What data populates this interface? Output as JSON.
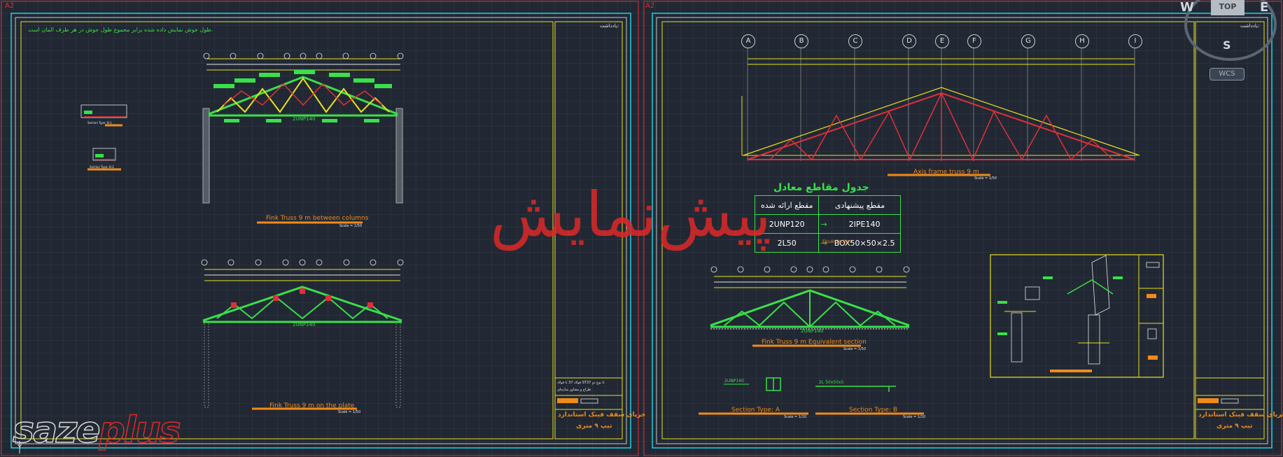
{
  "sheets": [
    {
      "tab": "A2"
    },
    {
      "tab": "A2"
    }
  ],
  "left_sheet": {
    "note": "طول جوش نمایش داده شده برابر مجموع طول جوش در هر طرف المان است.",
    "drawing1_title": "Fink Truss 9 m between columns",
    "drawing1_member": "2UNP140",
    "drawing2_title": "Fink Truss 9 m on the plate",
    "drawing2_member": "2UNP140",
    "scale_a": "Scale = 1/50",
    "scale_b": "Scale = 1/50",
    "detail_label_1": "Section Type: B-1",
    "detail_label_2": "Section Type: B-2",
    "titleblock_header": "یادداشت:",
    "titleblock_line1": "فولاد 37 تا فولاد ST37 تا نوع دو",
    "titleblock_line2": "طراح و مشاور سازه‌ای",
    "titleblock_title1": "خرپای سقف فینک استاندارد",
    "titleblock_title2": "تیپ ۹ متری"
  },
  "right_sheet": {
    "axes": [
      "A",
      "B",
      "C",
      "D",
      "E",
      "F",
      "G",
      "H",
      "I"
    ],
    "axis_title": "Axis frame truss 9 m",
    "axis_scale": "Scale = 1/50",
    "table": {
      "title": "جدول مقاطع معادل",
      "col1": "مقطع ارائه شده",
      "col2": "مقطع پیشنهادی",
      "rows": [
        {
          "given": "2UNP120",
          "arrow": "→",
          "proposed": "2IPE140"
        },
        {
          "given": "2L50",
          "arrow": "→",
          "proposed": "BOX50×50×2.5"
        }
      ],
      "footnote": "Equal Section"
    },
    "small_axes": [
      "A",
      "B",
      "C",
      "D",
      "E",
      "F",
      "G",
      "H",
      "I"
    ],
    "equivalent_title": "Fink Truss 9 m  Equivalent section",
    "equivalent_member": "2UNP140",
    "equivalent_scale": "Scale = 1/50",
    "section_a_title": "Section Type: A",
    "section_a_scale": "Scale = 1/10",
    "section_a_label": "2UNP140",
    "section_b_title": "Section Type: B",
    "section_b_scale": "Scale = 1/10",
    "section_b_label": "2L 50x50x5",
    "titleblock_header": "یادداشت:",
    "titleblock_title1": "خرپای سقف فینک استاندارد",
    "titleblock_title2": "تیپ ۹ متری"
  },
  "watermark": "پیش‌نمایش",
  "viewcube": {
    "w": "W",
    "top": "TOP",
    "e": "E",
    "s": "S",
    "wcs": "WCS"
  },
  "logo": {
    "part1": "saze",
    "part2": "plus"
  },
  "ucs": "Y",
  "colors": {
    "background": "#212833",
    "frame_red": "#e0303a",
    "frame_cyan": "#20d0e0",
    "yellow": "#e8e020",
    "green": "#39e04a",
    "orange": "#f08a1a"
  }
}
